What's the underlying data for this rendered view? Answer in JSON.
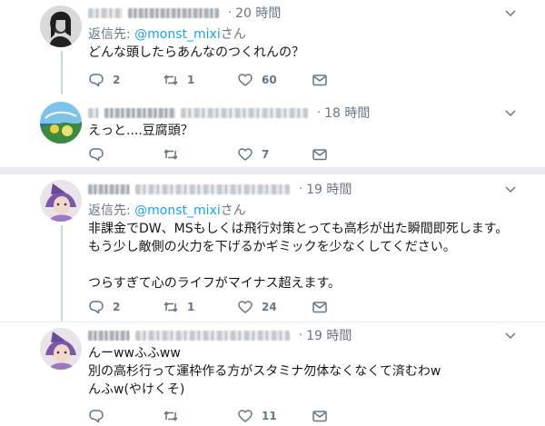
{
  "tweets": [
    {
      "time": "20 時間",
      "reply_label": "返信先: ",
      "reply_handle": "@monst_mixi",
      "reply_suffix": "さん",
      "lines": [
        "どんな頭したらあんなのつくれんの？"
      ],
      "counts": {
        "reply": "2",
        "retweet": "1",
        "like": "60"
      }
    },
    {
      "time": "18 時間",
      "lines": [
        "えっと....豆腐頭？"
      ],
      "counts": {
        "reply": "",
        "retweet": "",
        "like": "7"
      }
    },
    {
      "time": "19 時間",
      "reply_label": "返信先: ",
      "reply_handle": "@monst_mixi",
      "reply_suffix": "さん",
      "lines": [
        "非課金でDW、MSもしくは飛行対策とっても高杉が出た瞬間即死します。",
        "もう少し敵側の火力を下げるかギミックを少なくしてください。",
        "",
        "つらすぎて心のライフがマイナス超えます。"
      ],
      "counts": {
        "reply": "2",
        "retweet": "1",
        "like": "24"
      }
    },
    {
      "time": "19 時間",
      "lines": [
        "んーwwふふww",
        "別の高杉行って運枠作る方がスタミナ勿体なくなくて済むわw",
        "んふw(やけくそ)"
      ],
      "counts": {
        "reply": "",
        "retweet": "",
        "like": "11"
      }
    }
  ],
  "icons": {
    "reply": "reply-icon",
    "retweet": "retweet-icon",
    "like": "heart-icon",
    "dm": "envelope-icon",
    "more": "chevron-down-icon"
  },
  "colors": {
    "secondary": "#657786",
    "link": "#1da1f2",
    "divider": "#e6ecf0"
  }
}
